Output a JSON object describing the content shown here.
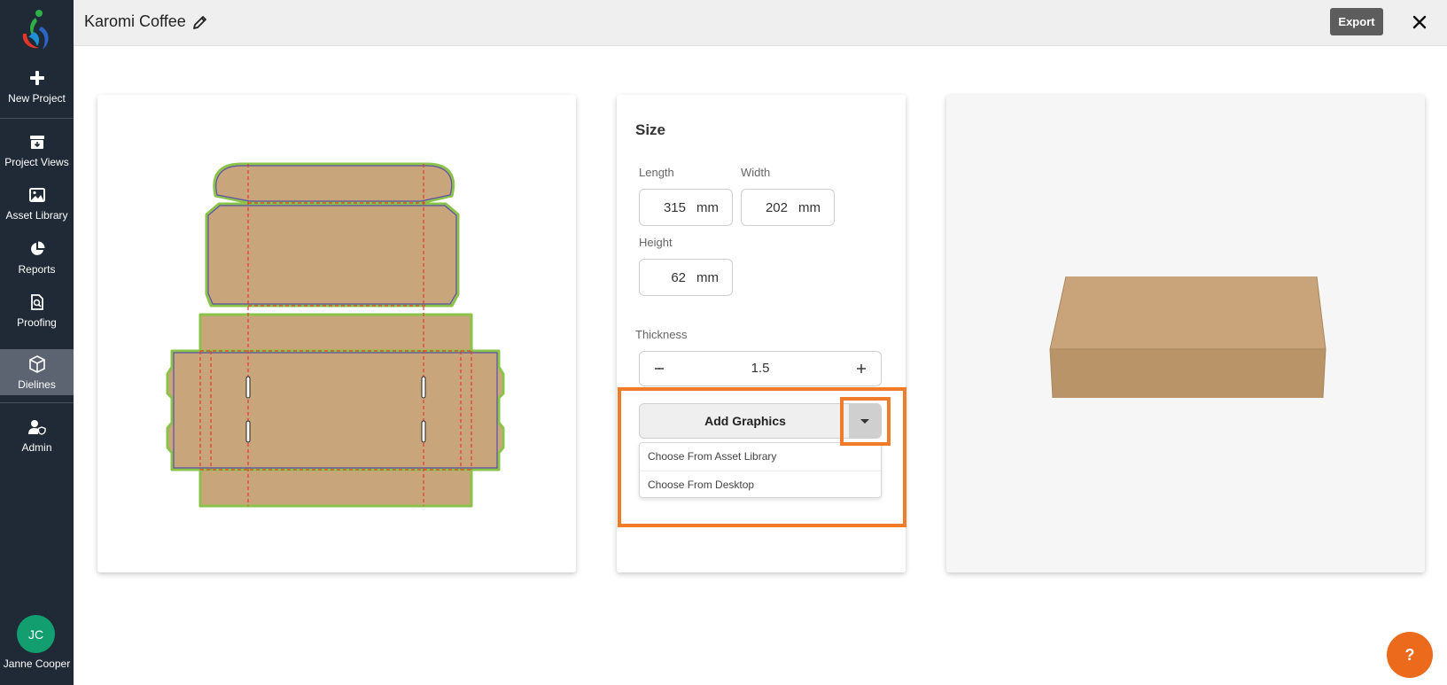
{
  "sidebar": {
    "items": [
      {
        "label": "New Project",
        "icon": "plus-icon"
      },
      {
        "label": "Project Views",
        "icon": "archive-icon"
      },
      {
        "label": "Asset Library",
        "icon": "image-icon"
      },
      {
        "label": "Reports",
        "icon": "pie-chart-icon"
      },
      {
        "label": "Proofing",
        "icon": "document-search-icon"
      },
      {
        "label": "Dielines",
        "icon": "box-icon",
        "active": true
      },
      {
        "label": "Admin",
        "icon": "user-shield-icon"
      }
    ],
    "user": {
      "initials": "JC",
      "name": "Janne Cooper"
    }
  },
  "header": {
    "title": "Karomi Coffee",
    "export_label": "Export"
  },
  "size_panel": {
    "title": "Size",
    "length": {
      "label": "Length",
      "value": "315",
      "unit": "mm"
    },
    "width": {
      "label": "Width",
      "value": "202",
      "unit": "mm"
    },
    "height": {
      "label": "Height",
      "value": "62",
      "unit": "mm"
    },
    "thickness": {
      "label": "Thickness",
      "value": "1.5"
    },
    "add_graphics": {
      "label": "Add Graphics",
      "options": [
        "Choose From Asset Library",
        "Choose From Desktop"
      ]
    }
  },
  "help_label": "?",
  "colors": {
    "sidebar_bg": "#1f2a36",
    "highlight": "#f07b2b",
    "kraft": "#c8a57a",
    "help_button": "#ec6a1c",
    "avatar": "#129e6e"
  }
}
